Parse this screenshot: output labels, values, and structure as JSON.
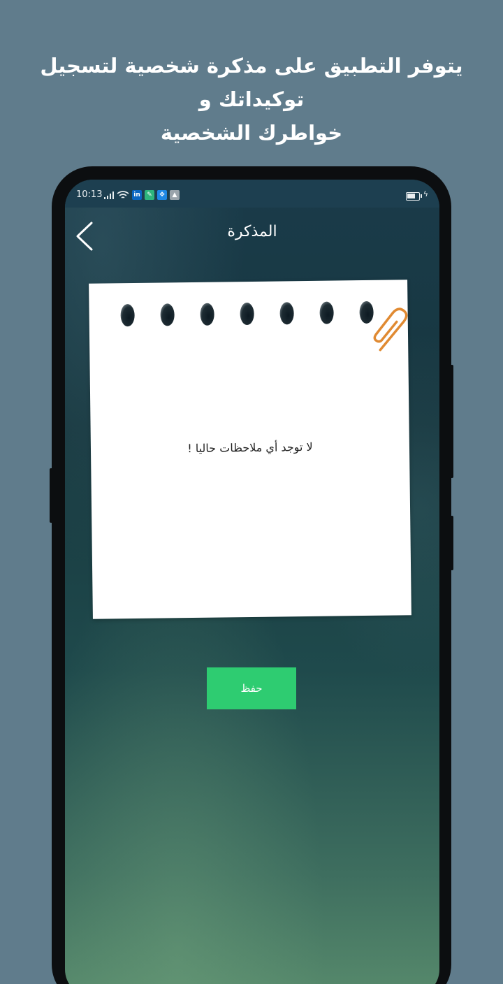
{
  "promo": {
    "line1": "يتوفر التطبيق على مذكرة شخصية لتسجيل توكيداتك و",
    "line2": "خواطرك الشخصية"
  },
  "status_bar": {
    "time": "10:13",
    "icons": [
      "signal-icon",
      "wifi-icon",
      "linkedin-icon",
      "app-notification-icon",
      "vpn-icon",
      "gallery-icon",
      "battery-icon",
      "charging-icon"
    ]
  },
  "app": {
    "title": "المذكرة",
    "empty_message": "لا توجد أي ملاحظات حاليا !",
    "save_label": "حفظ"
  },
  "colors": {
    "background": "#607c8c",
    "status_bar": "#1d3f50",
    "save_button": "#2ecc71",
    "paperclip": "#e08a32"
  }
}
